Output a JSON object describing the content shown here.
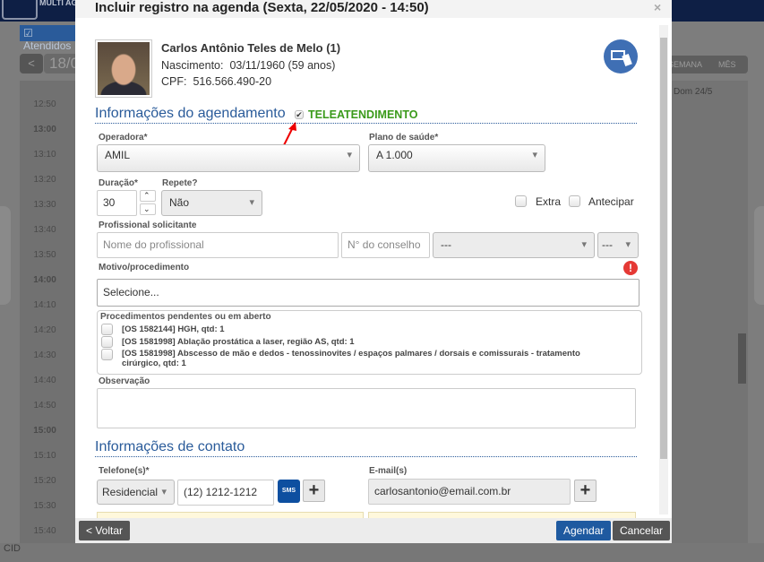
{
  "background": {
    "logo_text": "MULTI AGENDA",
    "checkbox_label": "Atendidos",
    "prev": "<",
    "date": "18/0",
    "view_week": "SEMANA",
    "view_month": "MÊS",
    "day_header": "Dom 24/5",
    "footer": "CID",
    "times": [
      "12:50",
      "13:00",
      "13:10",
      "13:20",
      "13:30",
      "13:40",
      "13:50",
      "14:00",
      "14:10",
      "14:20",
      "14:30",
      "14:40",
      "14:50",
      "15:00",
      "15:10",
      "15:20",
      "15:30",
      "15:40"
    ]
  },
  "modal": {
    "title": "Incluir registro na agenda (Sexta, 22/05/2020 - 14:50)",
    "close": "×"
  },
  "patient": {
    "name": "Carlos Antônio Teles de Melo (1)",
    "birth_label": "Nascimento:",
    "birth": "03/11/1960 (59 anos)",
    "cpf_label": "CPF:",
    "cpf": "516.566.490-20"
  },
  "schedule": {
    "title": "Informações do agendamento",
    "teleatendimento": "TELEATENDIMENTO",
    "teleatendimento_checked": true,
    "operadora_label": "Operadora*",
    "operadora": "AMIL",
    "plano_label": "Plano de saúde*",
    "plano": "A 1.000",
    "duracao_label": "Duração*",
    "duracao": "30",
    "repete_label": "Repete?",
    "repete": "Não",
    "extra": "Extra",
    "antecipar": "Antecipar",
    "profissional_label": "Profissional solicitante",
    "profissional_placeholder": "Nome do profissional",
    "conselho_placeholder": "N° do conselho",
    "conselho_tipo": "---",
    "uf": "---",
    "motivo_label": "Motivo/procedimento",
    "motivo_placeholder": "Selecione...",
    "pendentes_label": "Procedimentos pendentes ou em aberto",
    "pendentes": [
      "[OS 1582144] HGH, qtd: 1",
      "[OS 1581998] Ablação prostática a laser, região AS, qtd: 1",
      "[OS 1581998] Abscesso de mão e dedos - tenossinovites / espaços palmares / dorsais e comissurais - tratamento cirúrgico, qtd: 1"
    ],
    "observacao_label": "Observação"
  },
  "contact": {
    "title": "Informações de contato",
    "telefone_label": "Telefone(s)*",
    "telefone_tipo": "Residencial",
    "telefone": "(12) 1212-1212",
    "sms": "SMS",
    "email_label": "E-mail(s)",
    "email": "carlosantonio@email.com.br",
    "add": "+"
  },
  "footer": {
    "back": "< Voltar",
    "schedule": "Agendar",
    "cancel": "Cancelar"
  },
  "colors": {
    "primary": "#2a5b9a",
    "tele": "#3a9a1a",
    "alert": "#e53935"
  }
}
